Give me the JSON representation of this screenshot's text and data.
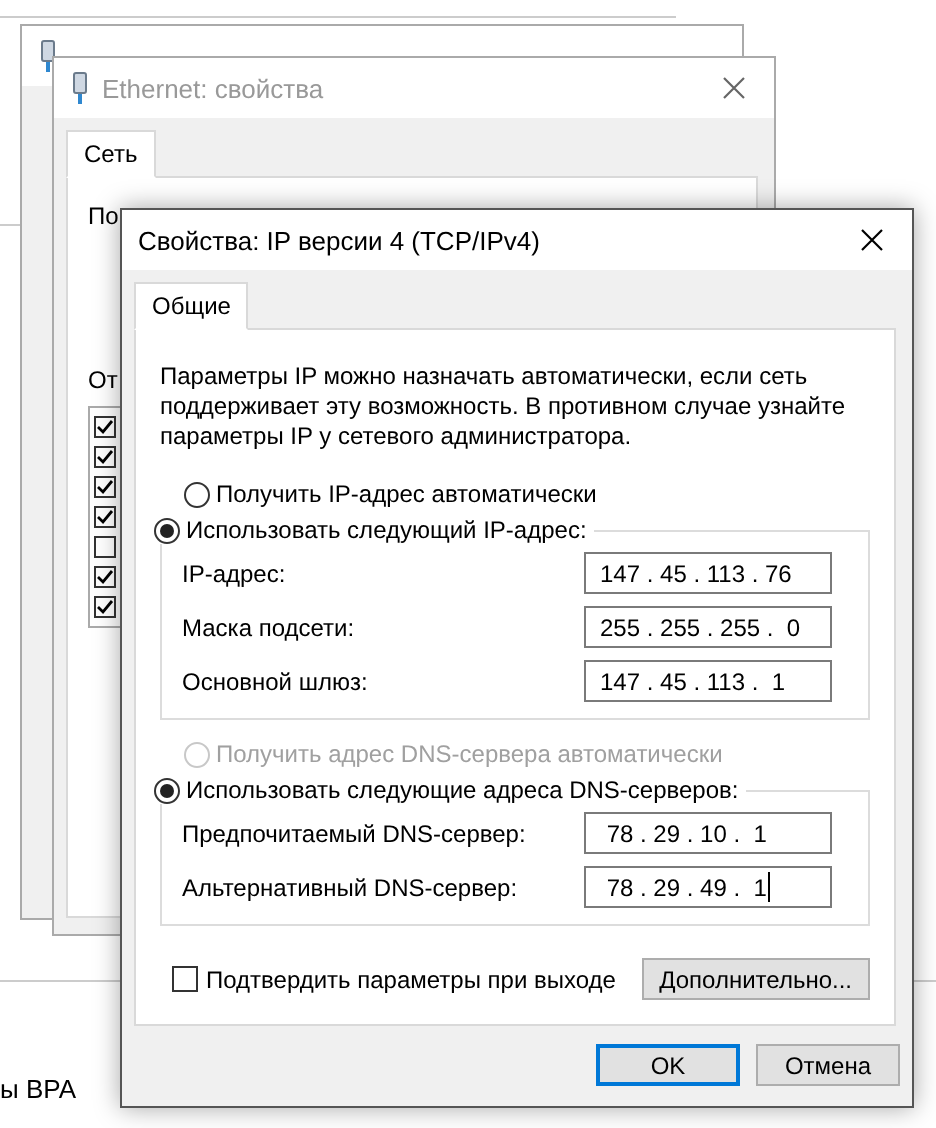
{
  "background": {
    "bottom_fragment": "ы ВРА",
    "properties_window": {
      "title": "Ethernet: свойства",
      "tabs": [
        {
          "label": "Сеть",
          "selected": true
        }
      ],
      "connect_label": "По",
      "components_label": "От",
      "components": [
        {
          "checked": true
        },
        {
          "checked": true
        },
        {
          "checked": true
        },
        {
          "checked": true
        },
        {
          "checked": false
        },
        {
          "checked": true
        },
        {
          "checked": true
        }
      ]
    }
  },
  "dialog": {
    "title": "Свойства: IP версии 4 (TCP/IPv4)",
    "tabs": [
      {
        "label": "Общие",
        "selected": true
      }
    ],
    "description": "Параметры IP можно назначать автоматически, если сеть поддерживает эту возможность. В противном случае узнайте параметры IP у сетевого администратора.",
    "ip_auto": {
      "label": "Получить IP-адрес автоматически",
      "selected": false,
      "disabled": false
    },
    "ip_manual": {
      "label": "Использовать следующий IP-адрес:",
      "selected": true,
      "disabled": false
    },
    "ip_fields": [
      {
        "label": "IP-адрес:",
        "value": "147 . 45 . 113 . 76",
        "focused": false
      },
      {
        "label": "Маска подсети:",
        "value": "255 . 255 . 255 .  0",
        "focused": false
      },
      {
        "label": "Основной шлюз:",
        "value": "147 . 45 . 113 .  1",
        "focused": false
      }
    ],
    "dns_auto": {
      "label": "Получить адрес DNS-сервера автоматически",
      "selected": false,
      "disabled": true
    },
    "dns_manual": {
      "label": "Использовать следующие адреса DNS-серверов:",
      "selected": true,
      "disabled": false
    },
    "dns_fields": [
      {
        "label": "Предпочитаемый DNS-сервер:",
        "value": " 78 . 29 . 10 .  1",
        "focused": false
      },
      {
        "label": "Альтернативный DNS-сервер:",
        "value": " 78 . 29 . 49 .  1",
        "focused": true
      }
    ],
    "confirm": {
      "label": "Подтвердить параметры при выходе",
      "checked": false
    },
    "advanced_button": "Дополнительно...",
    "buttons": [
      {
        "label": "OK",
        "default": true
      },
      {
        "label": "Отмена",
        "default": false
      }
    ]
  }
}
